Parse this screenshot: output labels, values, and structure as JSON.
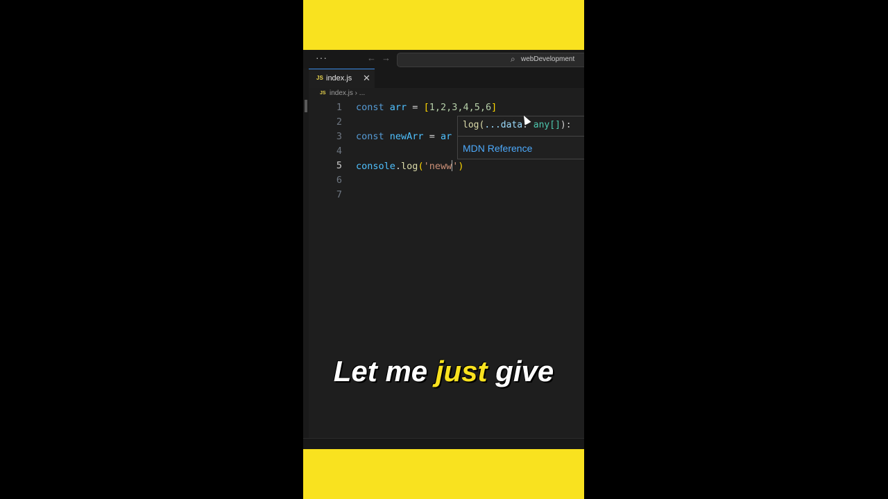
{
  "titlebar": {
    "more_icon": "ellipsis-icon",
    "workspace": "webDevelopment"
  },
  "tab": {
    "badge": "JS",
    "filename": "index.js",
    "close": "✕"
  },
  "breadcrumb": {
    "badge": "JS",
    "path": "index.js › ..."
  },
  "code": {
    "line_numbers": [
      "1",
      "2",
      "3",
      "4",
      "5",
      "6",
      "7"
    ],
    "line1": {
      "kw": "const",
      "var": "arr",
      "eq": " = ",
      "open": "[",
      "nums": "1,2,3,4,5,6",
      "close": "]"
    },
    "line3": {
      "kw": "const",
      "var": "newArr",
      "eq": " = ",
      "rest": "ar"
    },
    "line5": {
      "obj": "console",
      "dot": ".",
      "fn": "log",
      "open": "(",
      "str": "'neww",
      "quote": "'",
      "close": ")"
    }
  },
  "hover": {
    "fn": "log(",
    "param": "...data",
    "colon": ": ",
    "type": "any[]",
    "end": "):",
    "link": "MDN Reference"
  },
  "caption": {
    "part1": "Let me ",
    "highlight": "just",
    "part2": " give"
  },
  "colors": {
    "accent_yellow": "#f9e21f",
    "editor_bg": "#1e1e1e",
    "link_blue": "#4daafc"
  }
}
